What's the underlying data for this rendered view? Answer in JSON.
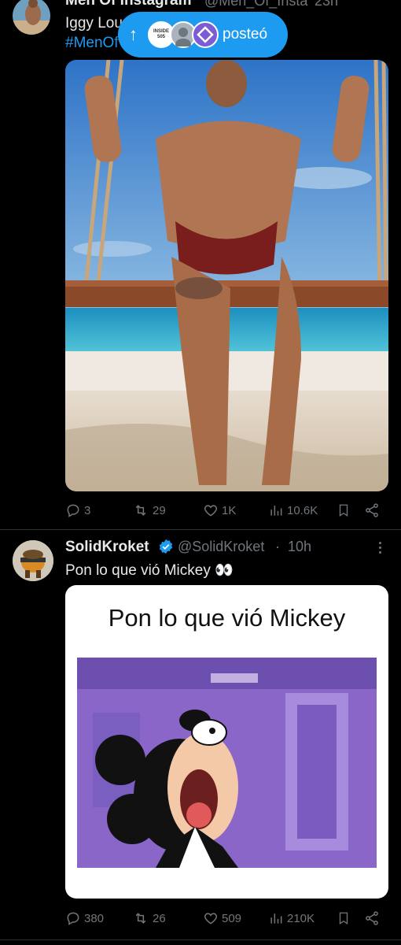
{
  "post1": {
    "display_name": "Men Of Instagram",
    "handle": "@Men_Of_Insta",
    "time": "23h",
    "text": "Iggy Lou",
    "hashtag": "#MenOf",
    "actions": {
      "replies": "3",
      "reposts": "29",
      "likes": "1K",
      "views": "10.6K"
    }
  },
  "new_posts_pill": {
    "label": "posteó",
    "avatar_text": "INSIDE 505"
  },
  "post2": {
    "display_name": "SolidKroket",
    "handle": "@SolidKroket",
    "time": "10h",
    "text": "Pon lo que vió Mickey 👀",
    "meme_caption": "Pon lo que vió Mickey",
    "actions": {
      "replies": "380",
      "reposts": "26",
      "likes": "509",
      "views": "210K"
    }
  },
  "colors": {
    "background": "#000000",
    "accent": "#1d9bf0",
    "muted": "#71767b",
    "verified": "#1d9bf0"
  }
}
